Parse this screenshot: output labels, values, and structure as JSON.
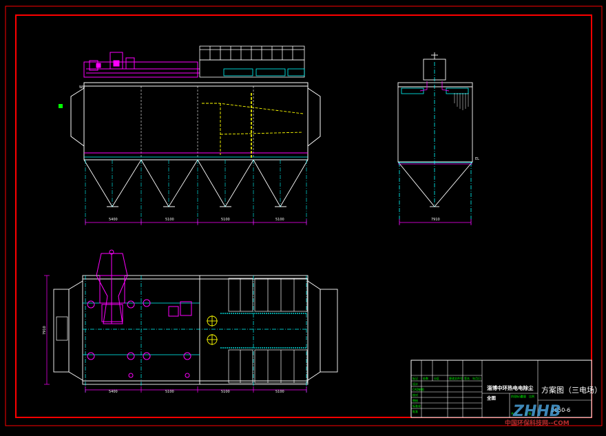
{
  "drawing": {
    "elevation_dims": [
      "5400",
      "5100",
      "5100",
      "5100"
    ],
    "side_dim": "7910",
    "plan_dims": [
      "5400",
      "5100",
      "5100",
      "5100"
    ],
    "plan_side_dim": "7910",
    "elev_tag_left": "W8",
    "side_tag_right": "EL"
  },
  "title_block": {
    "project": "淄博中环热电电除尘",
    "subtitle": "全图",
    "drawing_title": "方案图（三电场）",
    "drawing_number": "2650-6",
    "row_labels": [
      "标记",
      "处数",
      "分区",
      "更改文件号",
      "签名",
      "年月日"
    ],
    "left_labels": [
      "设计",
      "CAD制图",
      "校对",
      "审核",
      "标准化",
      "批准"
    ],
    "mid_labels": [
      "阶段标记",
      "重量",
      "比例",
      "共 张",
      "第 张"
    ]
  },
  "watermark": {
    "logo": "ZHHB",
    "url": "中国环保科技网--COM"
  },
  "colors": {
    "frame_outer": "#ff0000",
    "frame_inner": "#ff0000",
    "magenta": "#ff00ff",
    "cyan": "#00ffff",
    "yellow": "#ffff00",
    "white": "#ffffff",
    "green": "#00ff00"
  }
}
